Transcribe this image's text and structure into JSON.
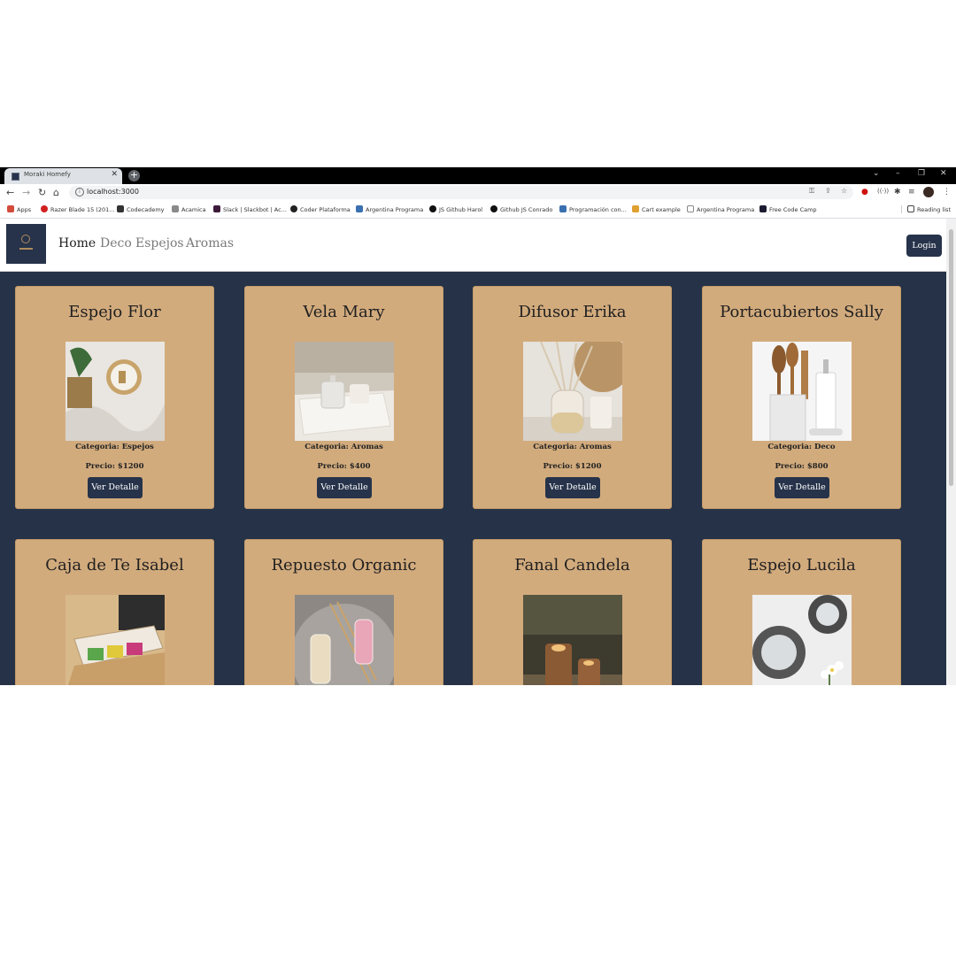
{
  "browser": {
    "tab_title": "Moraki Homefy",
    "url": "localhost:3000",
    "bookmarks": [
      {
        "label": "Apps",
        "color": "#d24b3b"
      },
      {
        "label": "Razer Blade 15 (201...",
        "color": "#d02020"
      },
      {
        "label": "Codecademy",
        "color": "#333333"
      },
      {
        "label": "Acamica",
        "color": "#8a8a8a"
      },
      {
        "label": "Slack | Slackbot | Ac...",
        "color": "#3d1a3a"
      },
      {
        "label": "Coder Plataforma",
        "color": "#222222"
      },
      {
        "label": "Argentina Programa",
        "color": "#3a6fb0"
      },
      {
        "label": "JS Github Harol",
        "color": "#111111"
      },
      {
        "label": "Github JS Conrado",
        "color": "#111111"
      },
      {
        "label": "Programación con...",
        "color": "#3a6fb0"
      },
      {
        "label": "Cart example",
        "color": "#e0a030"
      },
      {
        "label": "Argentina Programa",
        "color": "#888888"
      },
      {
        "label": "Free Code Camp",
        "color": "#1b1b32"
      }
    ],
    "reading_list": "Reading list"
  },
  "nav": {
    "links": [
      "Home",
      "Deco",
      "Espejos",
      "Aromas"
    ],
    "active": "Home",
    "login_label": "Login"
  },
  "products": [
    {
      "name": "Espejo Flor",
      "category": "Categoria: Espejos",
      "price": "Precio: $1200",
      "button": "Ver Detalle",
      "image": "round-mirror"
    },
    {
      "name": "Vela Mary",
      "category": "Categoria: Aromas",
      "price": "Precio: $400",
      "button": "Ver Detalle",
      "image": "candle-tray"
    },
    {
      "name": "Difusor Erika",
      "category": "Categoria: Aromas",
      "price": "Precio: $1200",
      "button": "Ver Detalle",
      "image": "reed-diffuser"
    },
    {
      "name": "Portacubiertos Sally",
      "category": "Categoria: Deco",
      "price": "Precio: $800",
      "button": "Ver Detalle",
      "image": "utensil-holder"
    },
    {
      "name": "Caja de Te Isabel",
      "category": "",
      "price": "",
      "button": "",
      "image": "tea-box"
    },
    {
      "name": "Repuesto Organic",
      "category": "",
      "price": "",
      "button": "",
      "image": "diffuser-refill"
    },
    {
      "name": "Fanal Candela",
      "category": "",
      "price": "",
      "button": "",
      "image": "glass-candles"
    },
    {
      "name": "Espejo Lucila",
      "category": "",
      "price": "",
      "button": "",
      "image": "mosaic-mirrors"
    }
  ],
  "colors": {
    "page_background": "#253247",
    "card": "#d2ab7d",
    "button": "#26334a"
  }
}
